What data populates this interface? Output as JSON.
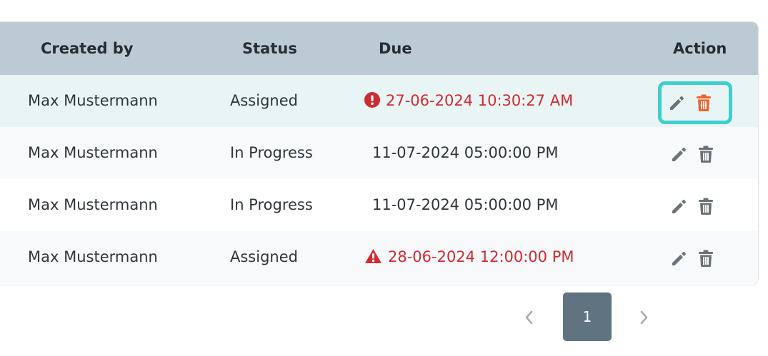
{
  "table": {
    "headers": {
      "created_by": "Created by",
      "status": "Status",
      "due": "Due",
      "action": "Action"
    },
    "rows": [
      {
        "created_by": "Max Mustermann",
        "status": "Assigned",
        "due": "27-06-2024 10:30:27 AM",
        "due_state": "overdue",
        "due_icon": "exclamation-circle-icon"
      },
      {
        "created_by": "Max Mustermann",
        "status": "In Progress",
        "due": "11-07-2024 05:00:00 PM",
        "due_state": "normal"
      },
      {
        "created_by": "Max Mustermann",
        "status": "In Progress",
        "due": "11-07-2024 05:00:00 PM",
        "due_state": "normal"
      },
      {
        "created_by": "Max Mustermann",
        "status": "Assigned",
        "due": "28-06-2024 12:00:00 PM",
        "due_state": "warning",
        "due_icon": "warning-triangle-icon"
      }
    ]
  },
  "pagination": {
    "current_page": "1",
    "prev_icon": "chevron-left-icon",
    "next_icon": "chevron-right-icon"
  },
  "colors": {
    "header_bg": "#bccbd3",
    "overdue_text": "#d02b31",
    "highlight_border": "#3fcfcf",
    "delete_active": "#f0622a",
    "icon_gray": "#6b7378",
    "page_active_bg": "#5f7480"
  }
}
